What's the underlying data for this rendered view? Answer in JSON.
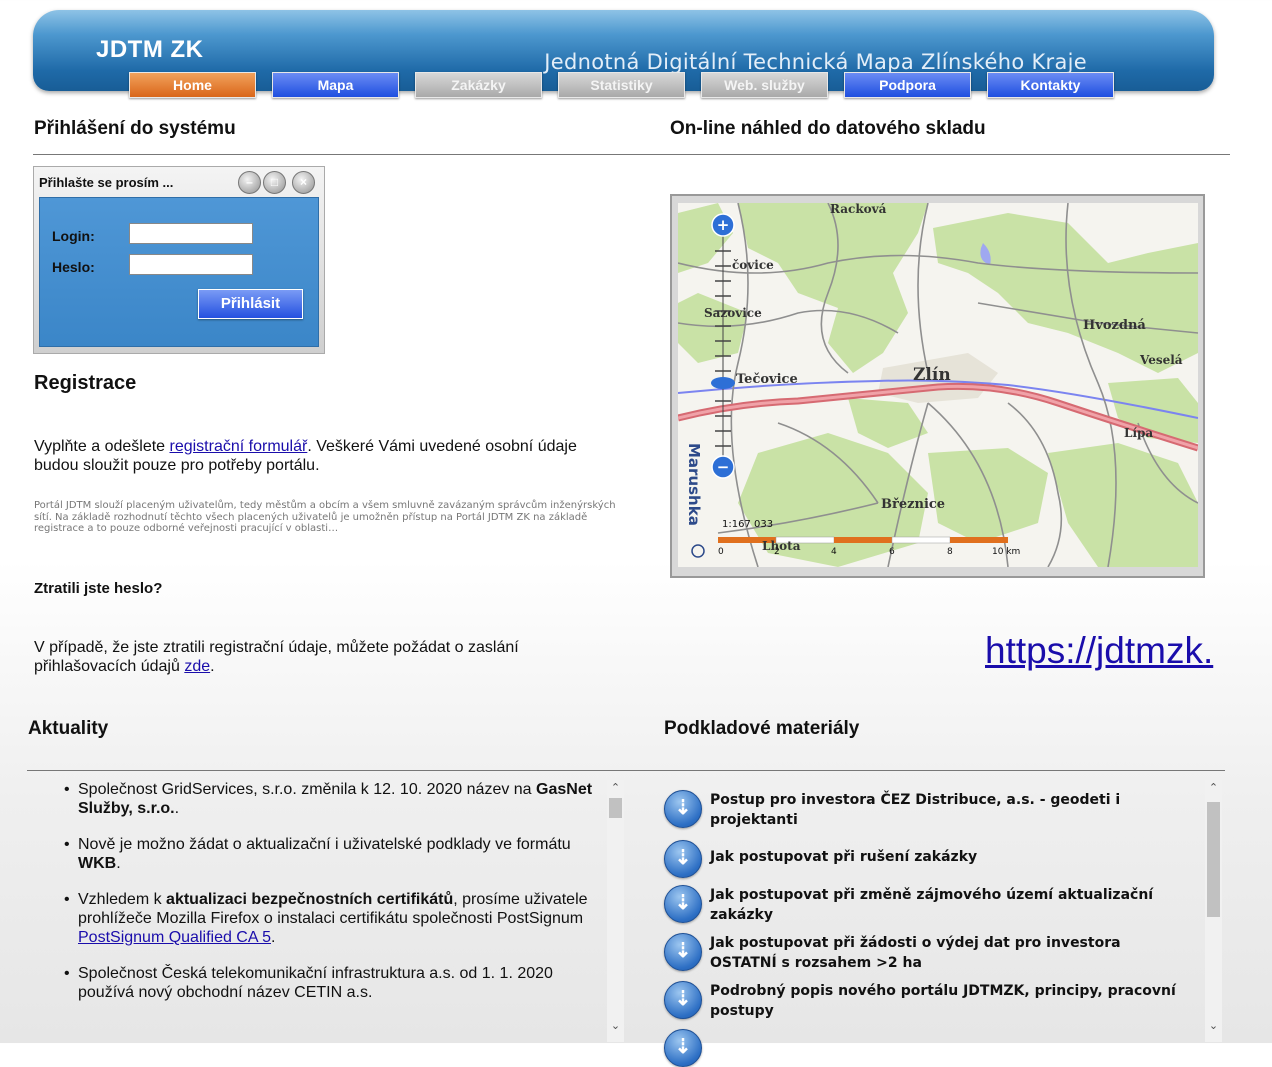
{
  "header": {
    "logo": "JDTM ZK",
    "slogan": "Jednotná Digitální Technická Mapa Zlínského Kraje",
    "nav": [
      {
        "label": "Home",
        "style": "orange"
      },
      {
        "label": "Mapa",
        "style": "blue"
      },
      {
        "label": "Zakázky",
        "style": "gray"
      },
      {
        "label": "Statistiky",
        "style": "gray"
      },
      {
        "label": "Web. služby",
        "style": "gray"
      },
      {
        "label": "Podpora",
        "style": "blue"
      },
      {
        "label": "Kontakty",
        "style": "blue"
      }
    ]
  },
  "login": {
    "section_title": "Přihlášení do systému",
    "window_title": "Přihlašte se prosím ...",
    "login_label": "Login:",
    "password_label": "Heslo:",
    "login_value": "",
    "password_value": "",
    "submit_label": "Přihlásit"
  },
  "registration": {
    "title": "Registrace",
    "text_before": "Vyplňte a odešlete ",
    "link": "registrační formulář",
    "text_after": ". Veškeré Vámi uvedené osobní údaje budou sloužit pouze pro potřeby portálu.",
    "note": "Portál JDTM slouží placeným uživatelům, tedy městům a obcím a všem smluvně zavázaným správcům inženýrských sítí. Na základě rozhodnutí těchto všech placených uživatelů je umožněn přístup na Portál JDTM ZK na základě registrace a to pouze odborné veřejnosti pracující v oblasti…"
  },
  "lost_password": {
    "title": "Ztratili jste heslo?",
    "text": "V případě, že jste ztratili registrační údaje, můžete požádat o zaslání přihlašovacích údajů ",
    "link": "zde",
    "text_end": "."
  },
  "map_section": {
    "title": "On-line náhled do datového skladu",
    "places": [
      "Racková",
      "čovice",
      "Sazovice",
      "Hvozdná",
      "Veselá",
      "Tečovice",
      "Zlín",
      "Lípa",
      "Březnice",
      "Lhota"
    ],
    "side_label": "Marushka",
    "scale_text": "1:167 033",
    "scale_ticks": [
      "0",
      "2",
      "4",
      "6",
      "8",
      "10 km"
    ],
    "url": "https://jdtmzk."
  },
  "news": {
    "title": "Aktuality",
    "items": [
      {
        "before": "Společnost GridServices, s.r.o. změnila k 12. 10. 2020 název na ",
        "bold": "GasNet Služby, s.r.o.",
        "after": "."
      },
      {
        "before": "Nově je možno žádat o aktualizační i uživatelské podklady ve formátu ",
        "bold": "WKB",
        "after": "."
      },
      {
        "before": "Vzhledem k ",
        "bold": "aktualizaci bezpečnostních certifikátů",
        "after": ", prosíme uživatele prohlížeče Mozilla Firefox o instalaci certifikátu společnosti PostSignum ",
        "link": "PostSignum Qualified CA 5",
        "end": "."
      },
      {
        "before": "Společnost Česká telekomunikační infrastruktura a.s. od 1. 1. 2020 používá nový obchodní název CETIN a.s.",
        "bold": "",
        "after": ""
      }
    ]
  },
  "materials": {
    "title": "Podkladové materiály",
    "items": [
      "Postup pro investora ČEZ Distribuce, a.s. - geodeti i projektanti",
      "Jak postupovat při rušení zakázky",
      "Jak postupovat při změně zájmového území aktualizační zakázky",
      "Jak postupovat při žádosti o výdej dat pro investora OSTATNÍ s rozsahem >2 ha",
      "Podrobný popis nového portálu JDTMZK, principy, pracovní postupy"
    ]
  }
}
